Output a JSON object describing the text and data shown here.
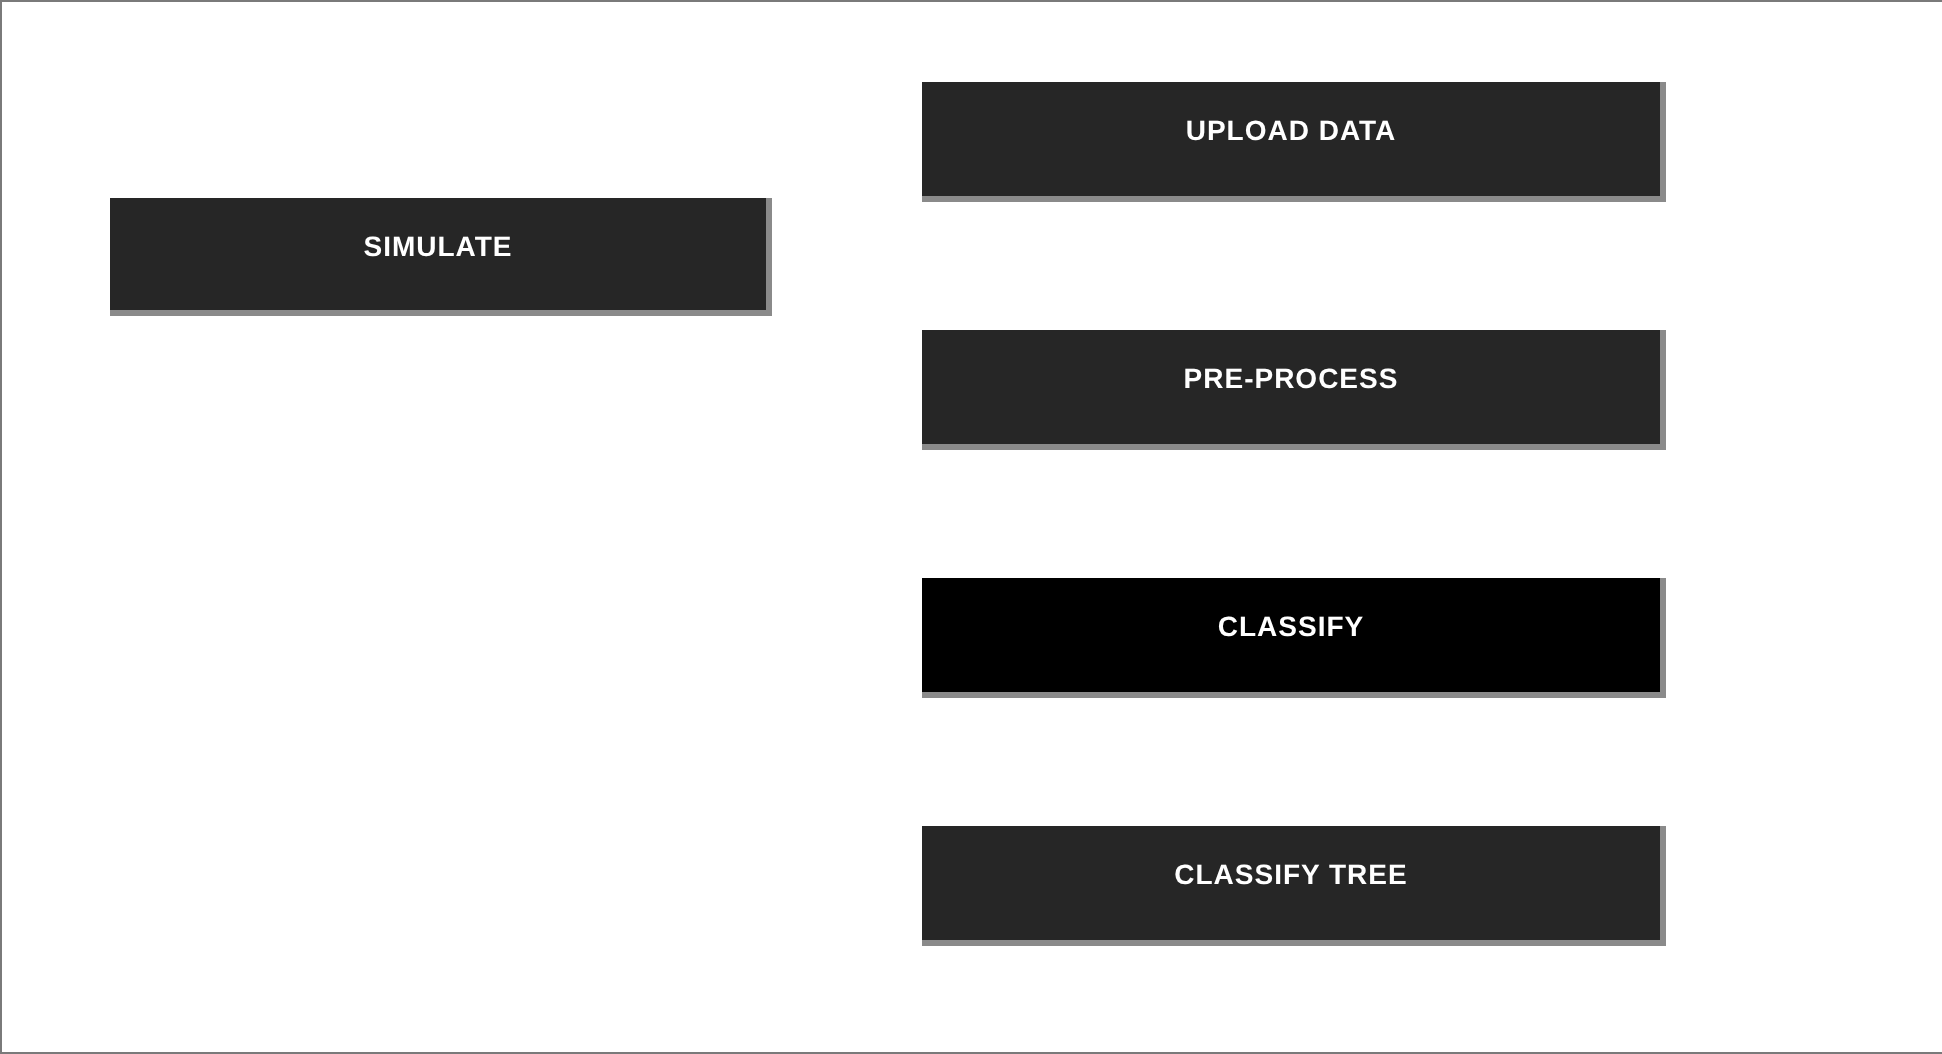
{
  "left_buttons": [
    {
      "label": "SIMULATE",
      "selected": false
    }
  ],
  "right_buttons": [
    {
      "label": "UPLOAD DATA",
      "selected": false
    },
    {
      "label": "PRE-PROCESS",
      "selected": false
    },
    {
      "label": "CLASSIFY",
      "selected": true
    },
    {
      "label": "CLASSIFY TREE",
      "selected": false
    }
  ]
}
